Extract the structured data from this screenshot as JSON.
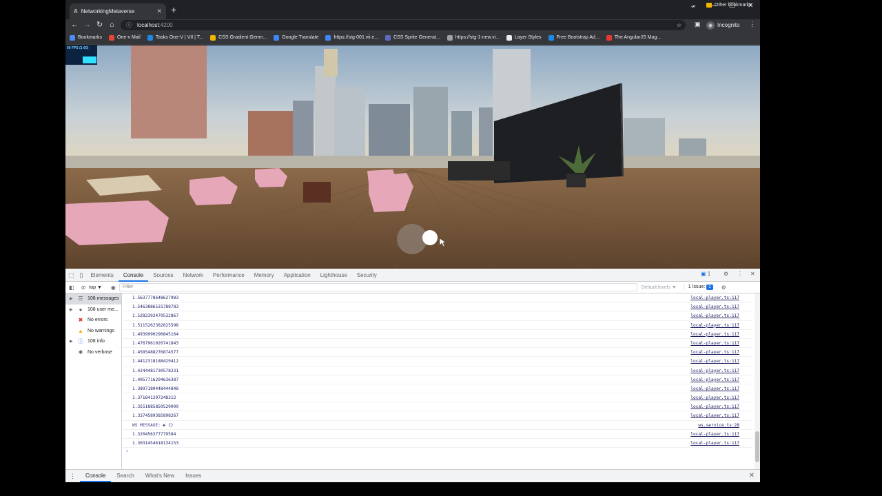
{
  "browser": {
    "tab_title": "NetworkingMetaverse",
    "tab_favicon": "A",
    "new_tab": "+",
    "url": "localhost",
    "url_port": ":4200",
    "profile": "Incognito"
  },
  "bookmarks": [
    {
      "label": "Bookmarks",
      "color": "#4c8bf5"
    },
    {
      "label": "One-v Mail",
      "color": "#ea4335"
    },
    {
      "label": "Tasks One-V | VII | T...",
      "color": "#1e88e5"
    },
    {
      "label": "CSS Gradient Gener...",
      "color": "#f4b400"
    },
    {
      "label": "Google Translate",
      "color": "#4285f4"
    },
    {
      "label": "https://stg-001.vii.e...",
      "color": "#4285f4"
    },
    {
      "label": "CSS Sprite Generat...",
      "color": "#5c6bc0"
    },
    {
      "label": "https://stg-1-new.vi...",
      "color": "#9aa0a6"
    },
    {
      "label": "Layer Styles",
      "color": "#e8eaed"
    },
    {
      "label": "Free Bootstrap Ad...",
      "color": "#1e88e5"
    },
    {
      "label": "The AngularJS Mag...",
      "color": "#e53935"
    }
  ],
  "bookmarks_more": "»",
  "bookmarks_other": "Other bookmarks",
  "fps": "60 FPS (1-60)",
  "devtools": {
    "tabs": [
      "Elements",
      "Console",
      "Sources",
      "Network",
      "Performance",
      "Memory",
      "Application",
      "Lighthouse",
      "Security"
    ],
    "active_tab": "Console",
    "issues_badge": "1",
    "context": "top ▼",
    "filter_placeholder": "Filter",
    "levels": "Default levels ▼",
    "issues_label": "1 Issue:",
    "issues_count": "1",
    "sidebar": [
      {
        "label": "108 messages",
        "icon": "list-icon",
        "glyph": "☰",
        "color": "#5f6368",
        "tri": "▶",
        "selected": true
      },
      {
        "label": "108 user me...",
        "icon": "user-icon",
        "glyph": "●",
        "color": "#5f6368",
        "tri": "▶",
        "selected": false
      },
      {
        "label": "No errors",
        "icon": "error-icon",
        "glyph": "✖",
        "color": "#d93025",
        "tri": "",
        "selected": false
      },
      {
        "label": "No warnings",
        "icon": "warning-icon",
        "glyph": "▲",
        "color": "#f9ab00",
        "tri": "",
        "selected": false
      },
      {
        "label": "108 info",
        "icon": "info-icon",
        "glyph": "ⓘ",
        "color": "#1a73e8",
        "tri": "▶",
        "selected": false
      },
      {
        "label": "No verbose",
        "icon": "bug-icon",
        "glyph": "✱",
        "color": "#5f6368",
        "tri": "",
        "selected": false
      }
    ],
    "log_rows": [
      {
        "value": "1.5637778648627983",
        "source": "local-player.ts:117"
      },
      {
        "value": "1.5463886531788783",
        "source": "local-player.ts:117"
      },
      {
        "value": "1.5282392470532867",
        "source": "local-player.ts:117"
      },
      {
        "value": "1.5115262382825598",
        "source": "local-player.ts:117"
      },
      {
        "value": "1.4939990290845164",
        "source": "local-player.ts:117"
      },
      {
        "value": "1.4767961020741843",
        "source": "local-player.ts:117"
      },
      {
        "value": "1.4585488276874577",
        "source": "local-player.ts:117"
      },
      {
        "value": "1.4412318188429412",
        "source": "local-player.ts:117"
      },
      {
        "value": "1.4244481730578231",
        "source": "local-player.ts:117"
      },
      {
        "value": "1.4057716294636387",
        "source": "local-player.ts:117"
      },
      {
        "value": "1.3897180448444848",
        "source": "local-player.ts:117"
      },
      {
        "value": "1.371841297248312",
        "source": "local-player.ts:117"
      },
      {
        "value": "1.3551885850529009",
        "source": "local-player.ts:117"
      },
      {
        "value": "1.3374589385898267",
        "source": "local-player.ts:117"
      },
      {
        "value": "WS MESSAGE: ▶ {}",
        "source": "ws.service.ts:28",
        "ws": true
      },
      {
        "value": "1.320456377779584",
        "source": "local-player.ts:117"
      },
      {
        "value": "1.3031454618134153",
        "source": "local-player.ts:117"
      }
    ],
    "drawer_tabs": [
      "Console",
      "Search",
      "What's New",
      "Issues"
    ],
    "drawer_active": "Console"
  }
}
